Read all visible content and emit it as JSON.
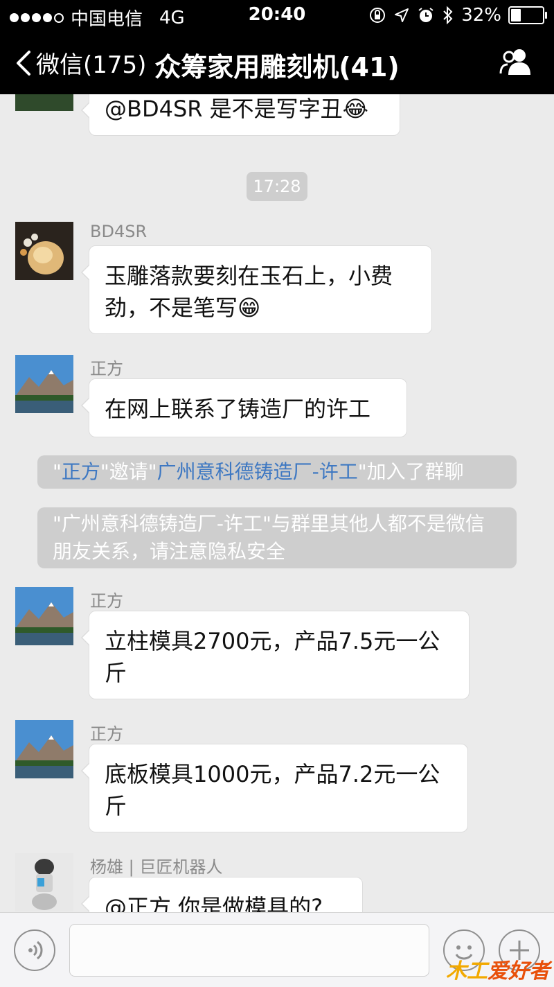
{
  "status_bar": {
    "carrier": "中国电信",
    "network": "4G",
    "time": "20:40",
    "battery": "32%",
    "battery_level": 0.32
  },
  "nav": {
    "back_label": "微信(175)",
    "title": "众筹家用雕刻机(41)",
    "icons": [
      "chevron-left-icon",
      "group-members-icon"
    ]
  },
  "chat": {
    "partial_message": "@BD4SR 是不是写字丑😂",
    "timestamp": "17:28",
    "messages": [
      {
        "sender": "BD4SR",
        "text": "玉雕落款要刻在玉石上，小费劲，不是笔写😁"
      },
      {
        "sender": "正方",
        "text": "在网上联系了铸造厂的许工"
      },
      {
        "sender": "正方",
        "text": "立柱模具2700元，产品7.5元一公斤"
      },
      {
        "sender": "正方",
        "text": "底板模具1000元，产品7.2元一公斤"
      },
      {
        "sender": "杨雄 | 巨匠机器人",
        "text": "@正方 你是做模具的?"
      }
    ],
    "system_invite": {
      "q1": "\"",
      "inviter": "正方",
      "mid": "\"邀请\"",
      "invitee": "广州意科德铸造厂-许工",
      "end": "\"加入了群聊"
    },
    "system_warning": "\"广州意科德铸造厂-许工\"与群里其他人都不是微信朋友关系，请注意隐私安全"
  },
  "input_bar": {
    "icons": [
      "voice-icon",
      "emoji-icon",
      "plus-icon"
    ]
  },
  "watermark": {
    "part1": "木工",
    "part2": "爱好者"
  },
  "colors": {
    "link": "#3e78c2",
    "background": "#ebebeb",
    "header": "#000000"
  }
}
